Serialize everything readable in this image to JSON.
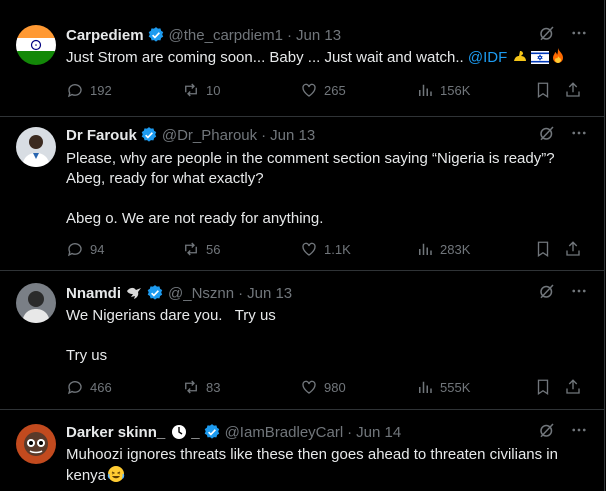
{
  "tweets": [
    {
      "name": "Carpediem",
      "handle": "@the_carpdiem1",
      "time": "Jun 13",
      "text": "Just Strom are coming soon... Baby ... Just wait and watch.. ",
      "mention": "@IDF",
      "stats": {
        "replies": "192",
        "reposts": "10",
        "likes": "265",
        "views": "156K"
      }
    },
    {
      "name": "Dr Farouk",
      "handle": "@Dr_Pharouk",
      "time": "Jun 13",
      "text_line1": "Please, why are people in the comment section saying “Nigeria is ready”? Abeg, ready for what exactly?",
      "text_line2": "Abeg o. We are not ready for anything.",
      "stats": {
        "replies": "94",
        "reposts": "56",
        "likes": "1.1K",
        "views": "283K"
      }
    },
    {
      "name": "Nnamdi",
      "handle": "@_Nsznn",
      "time": "Jun 13",
      "text_line1": "We Nigerians dare you.   Try us",
      "text_line2": "Try us",
      "stats": {
        "replies": "466",
        "reposts": "83",
        "likes": "980",
        "views": "555K"
      }
    },
    {
      "name": "Darker skinn_",
      "name_suffix": "_",
      "handle": "@IamBradleyCarl",
      "time": "Jun 14",
      "text": "Muhoozi ignores threats like these then goes ahead to threaten civilians in kenya"
    }
  ],
  "separator": "·",
  "colors": {
    "accent": "#1d9bf0",
    "muted": "#71767b",
    "border": "#2f3336"
  }
}
